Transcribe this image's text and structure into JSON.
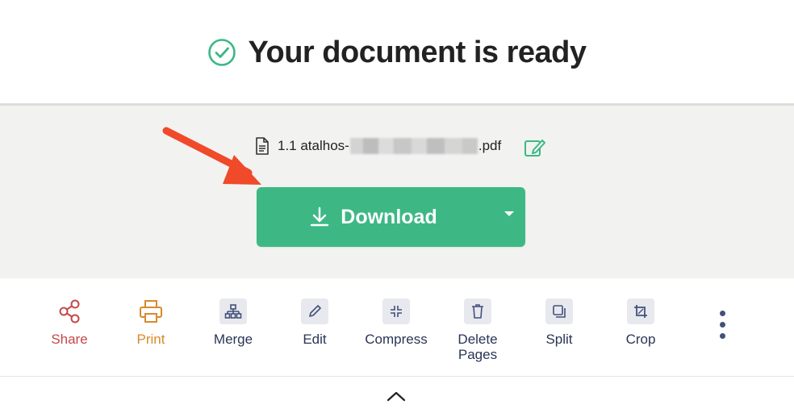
{
  "header": {
    "title": "Your document is ready"
  },
  "file": {
    "name_prefix": "1.1 atalhos-",
    "name_suffix": ".pdf"
  },
  "download": {
    "label": "Download"
  },
  "tools": [
    {
      "label": "Share",
      "icon": "share-icon"
    },
    {
      "label": "Print",
      "icon": "printer-icon"
    },
    {
      "label": "Merge",
      "icon": "merge-icon"
    },
    {
      "label": "Edit",
      "icon": "pencil-icon"
    },
    {
      "label": "Compress",
      "icon": "compress-icon"
    },
    {
      "label": "Delete\nPages",
      "icon": "trash-icon"
    },
    {
      "label": "Split",
      "icon": "split-icon"
    },
    {
      "label": "Crop",
      "icon": "crop-icon"
    }
  ],
  "colors": {
    "accent_green": "#3db884",
    "share": "#c44848",
    "print": "#d98a2b",
    "tool_text": "#2a3556",
    "arrow": "#f04a2a"
  }
}
